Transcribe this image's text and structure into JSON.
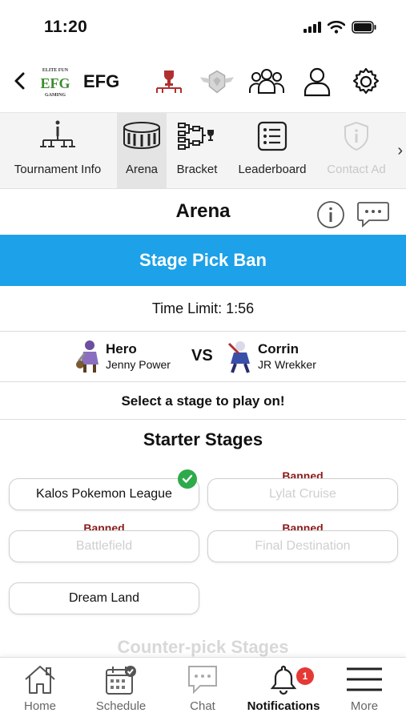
{
  "status_bar": {
    "time": "11:20"
  },
  "header": {
    "logo_text": [
      "ELITE FUN",
      "EFG",
      "GAMING"
    ],
    "app_name": "EFG"
  },
  "tabs": [
    {
      "label": "Tournament Info",
      "icon": "tournament-info-icon"
    },
    {
      "label": "Arena",
      "icon": "stadium-icon",
      "active": true
    },
    {
      "label": "Bracket",
      "icon": "bracket-icon"
    },
    {
      "label": "Leaderboard",
      "icon": "list-icon"
    },
    {
      "label": "Contact Ad",
      "icon": "shield-info-icon",
      "disabled": true
    }
  ],
  "arena": {
    "title": "Arena",
    "banner": "Stage Pick Ban",
    "time_limit": "Time Limit: 1:56",
    "player1": {
      "character": "Hero",
      "tag": "Jenny Power"
    },
    "vs": "VS",
    "player2": {
      "character": "Corrin",
      "tag": "JR Wrekker"
    },
    "prompt": "Select a stage to play on!"
  },
  "starter_stages": {
    "title": "Starter Stages",
    "banned_label": "Banned",
    "stages": [
      {
        "name": "Kalos Pokemon League",
        "status": "selected"
      },
      {
        "name": "Lylat Cruise",
        "status": "banned"
      },
      {
        "name": "Battlefield",
        "status": "banned"
      },
      {
        "name": "Final Destination",
        "status": "banned"
      },
      {
        "name": "Dream Land",
        "status": "available"
      }
    ]
  },
  "counterpick": {
    "title": "Counter-pick Stages"
  },
  "bottom_nav": [
    {
      "label": "Home",
      "icon": "home-icon"
    },
    {
      "label": "Schedule",
      "icon": "calendar-icon"
    },
    {
      "label": "Chat",
      "icon": "chat-icon"
    },
    {
      "label": "Notifications",
      "icon": "bell-icon",
      "active": true,
      "badge": "1"
    },
    {
      "label": "More",
      "icon": "menu-icon"
    }
  ],
  "colors": {
    "banner": "#1da1e8",
    "banned_text": "#8b1a1a",
    "check": "#2eaa4a",
    "badge": "#e53935"
  }
}
